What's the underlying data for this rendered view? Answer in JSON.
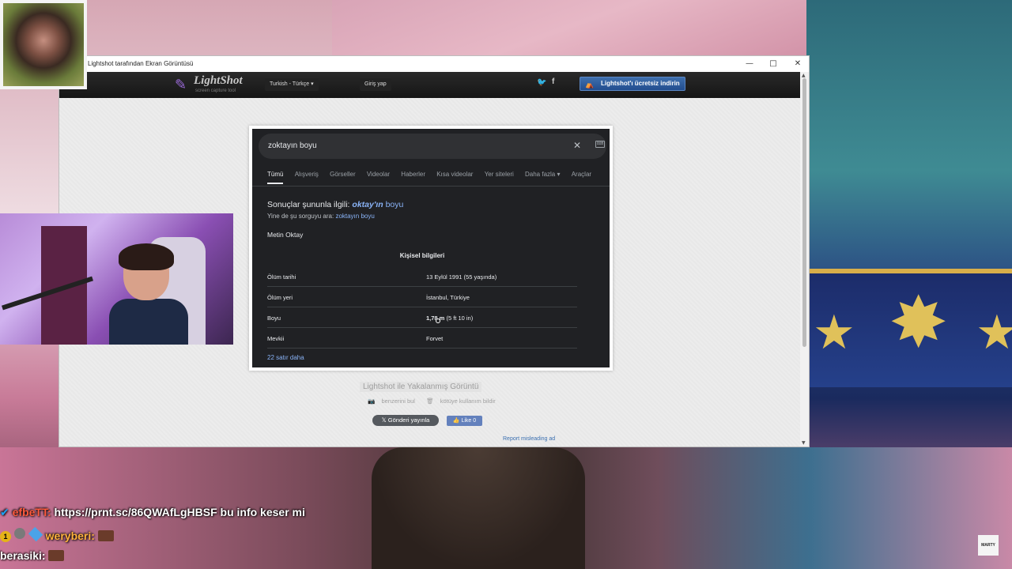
{
  "window": {
    "title": "Lightshot tarafından Ekran Görüntüsü",
    "minimize": "—",
    "maximize": "□",
    "close": "✕"
  },
  "lightshot": {
    "logo": "LightShot",
    "tagline": "screen capture tool",
    "language": "Turkish - Türkçe",
    "login": "Giriş yap",
    "download": "Lightshot'ı ücretsiz indirin",
    "caption": "Lightshot ile Yakalanmış Görüntü",
    "similar": "benzerini bul",
    "report_abuse": "kötüye kullanım bildir",
    "tweet": "Gönderi yayınla",
    "like": "Like 0",
    "report_ad": "Report misleading ad"
  },
  "google": {
    "query": "zoktayın boyu",
    "tabs": [
      "Tümü",
      "Alışveriş",
      "Görseller",
      "Videolar",
      "Haberler",
      "Kısa videolar",
      "Yer siteleri",
      "Daha fazla ▾",
      "Araçlar"
    ],
    "correction_prefix": "Sonuçlar şununla ilgili:",
    "correction_em": "oktay'ın",
    "correction_rest": "boyu",
    "alt_prefix": "Yine de şu sorguyu ara:",
    "alt_query": "zoktayın boyu",
    "entity": "Metin Oktay",
    "section": "Kişisel bilgileri",
    "rows": [
      {
        "k": "Ölüm tarihi",
        "v": "13 Eylül 1991 (55 yaşında)"
      },
      {
        "k": "Ölüm yeri",
        "v": "İstanbul, Türkiye"
      },
      {
        "k": "Boyu",
        "v_bold": "1,78 m",
        "v": " (5 ft 10 in)"
      },
      {
        "k": "Mevkii",
        "v": "Forvet"
      }
    ],
    "more": "22 satır daha"
  },
  "chat": {
    "line1_user": "efbeTT:",
    "line1_text": "https://prnt.sc/86QWAfLgHBSF bu info keser mi",
    "line2_user": "weryberi:",
    "line3_user": "berasiki:",
    "badge_number": "1"
  },
  "watermark": "MARTY"
}
